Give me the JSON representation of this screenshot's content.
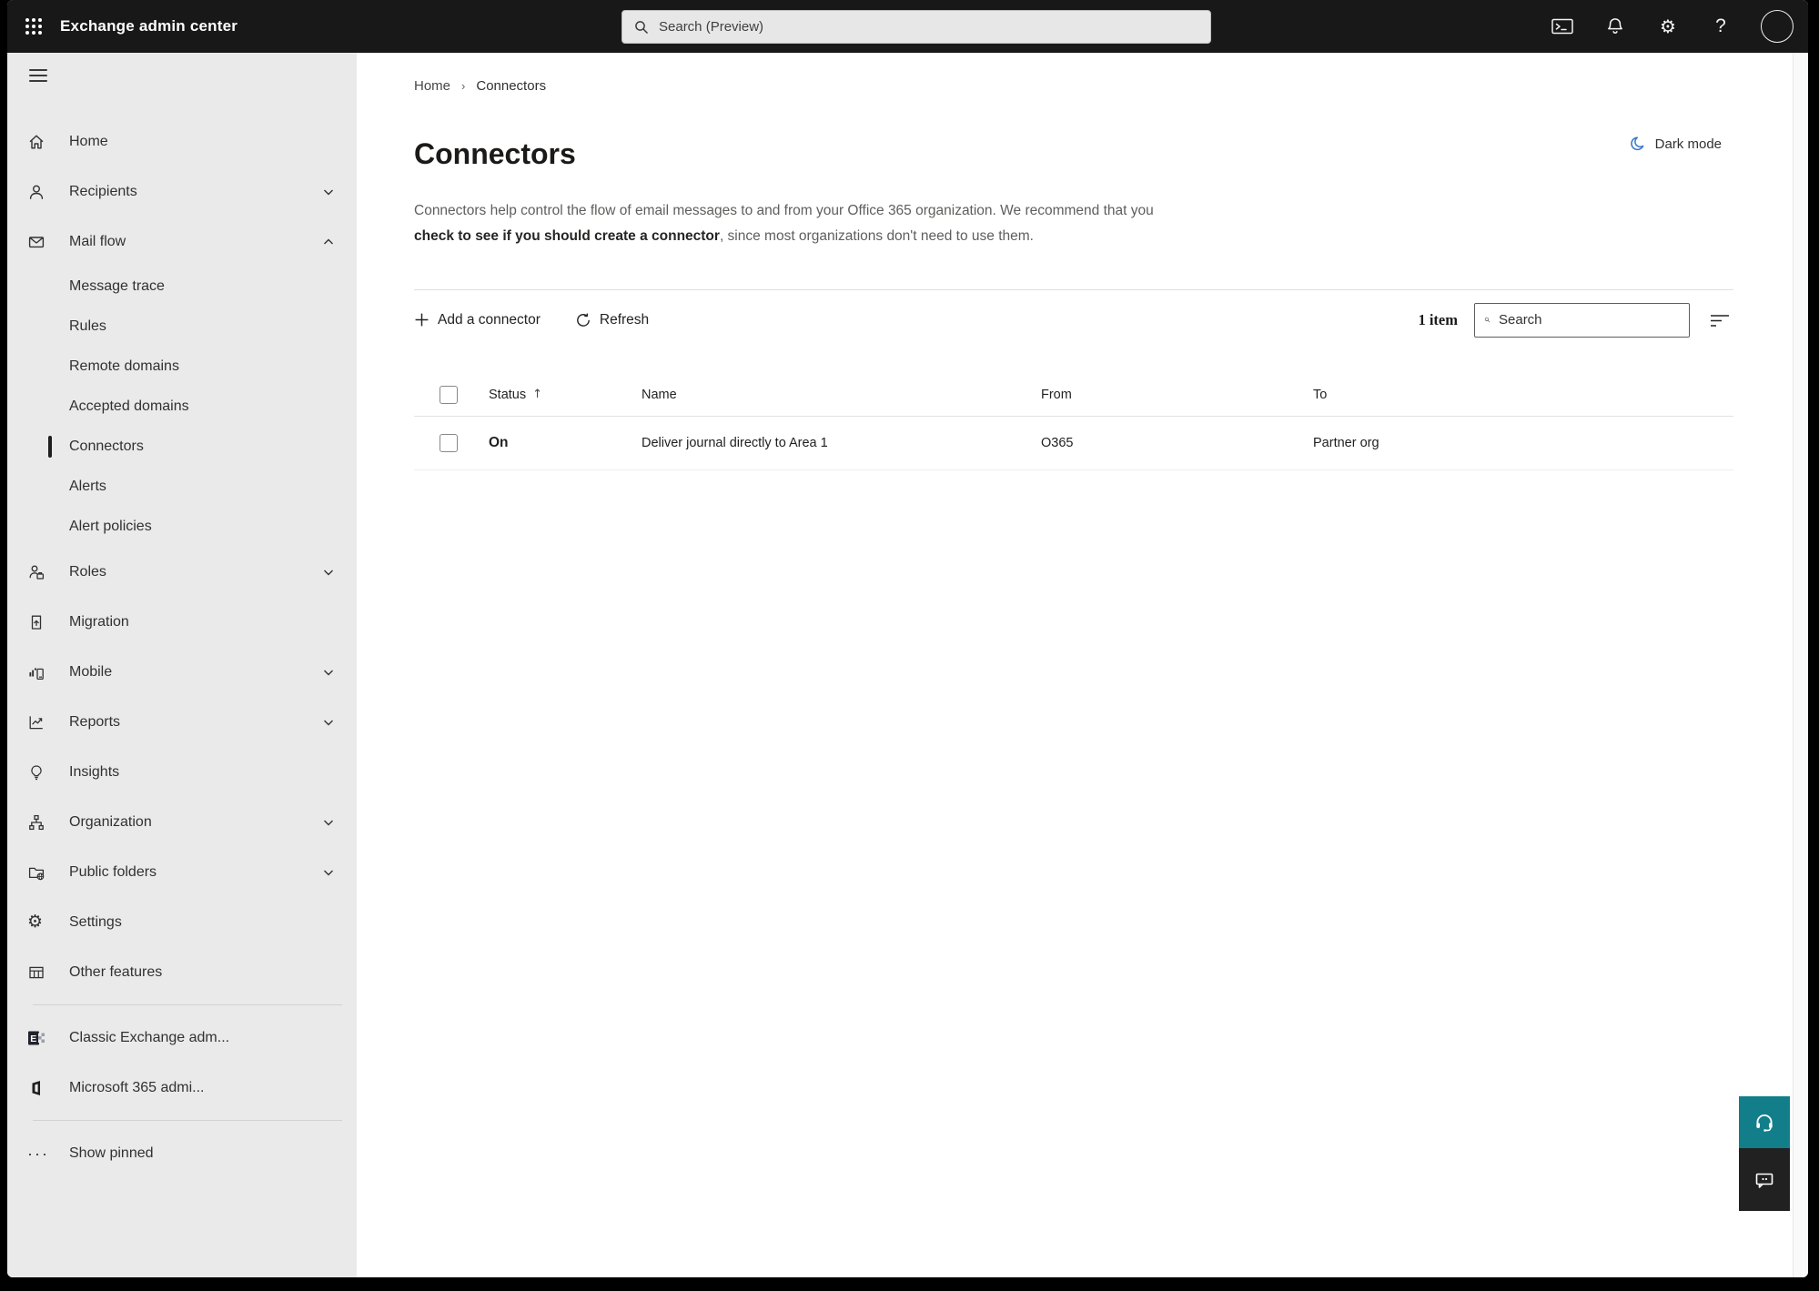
{
  "topbar": {
    "title": "Exchange admin center",
    "search_placeholder": "Search (Preview)"
  },
  "breadcrumb": {
    "home": "Home",
    "current": "Connectors"
  },
  "dark_mode_label": "Dark mode",
  "page": {
    "title": "Connectors",
    "description_1": "Connectors help control the flow of email messages to and from your Office 365 organization. We recommend that you ",
    "description_link": "check to see if you should create a connector",
    "description_2": ", since most organizations don't need to use them."
  },
  "toolbar": {
    "add_label": "Add a connector",
    "refresh_label": "Refresh",
    "count": "1 item",
    "search_placeholder": "Search"
  },
  "table": {
    "headers": {
      "status": "Status",
      "name": "Name",
      "from": "From",
      "to": "To"
    },
    "rows": [
      {
        "status": "On",
        "name": "Deliver journal directly to Area 1",
        "from": "O365",
        "to": "Partner org"
      }
    ]
  },
  "sidebar": {
    "items": [
      {
        "label": "Home"
      },
      {
        "label": "Recipients"
      },
      {
        "label": "Mail flow"
      },
      {
        "label": "Message trace"
      },
      {
        "label": "Rules"
      },
      {
        "label": "Remote domains"
      },
      {
        "label": "Accepted domains"
      },
      {
        "label": "Connectors"
      },
      {
        "label": "Alerts"
      },
      {
        "label": "Alert policies"
      },
      {
        "label": "Roles"
      },
      {
        "label": "Migration"
      },
      {
        "label": "Mobile"
      },
      {
        "label": "Reports"
      },
      {
        "label": "Insights"
      },
      {
        "label": "Organization"
      },
      {
        "label": "Public folders"
      },
      {
        "label": "Settings"
      },
      {
        "label": "Other features"
      }
    ],
    "footer": [
      {
        "label": "Classic Exchange adm..."
      },
      {
        "label": "Microsoft 365 admi..."
      }
    ],
    "show_pinned": "Show pinned"
  },
  "colors": {
    "topbar": "#181818",
    "sidebar": "#eaeaea",
    "accent_teal": "#127e8a",
    "feedback_dark": "#212121",
    "moon_blue": "#3b78c8",
    "selected_marker": "#201f1e"
  }
}
